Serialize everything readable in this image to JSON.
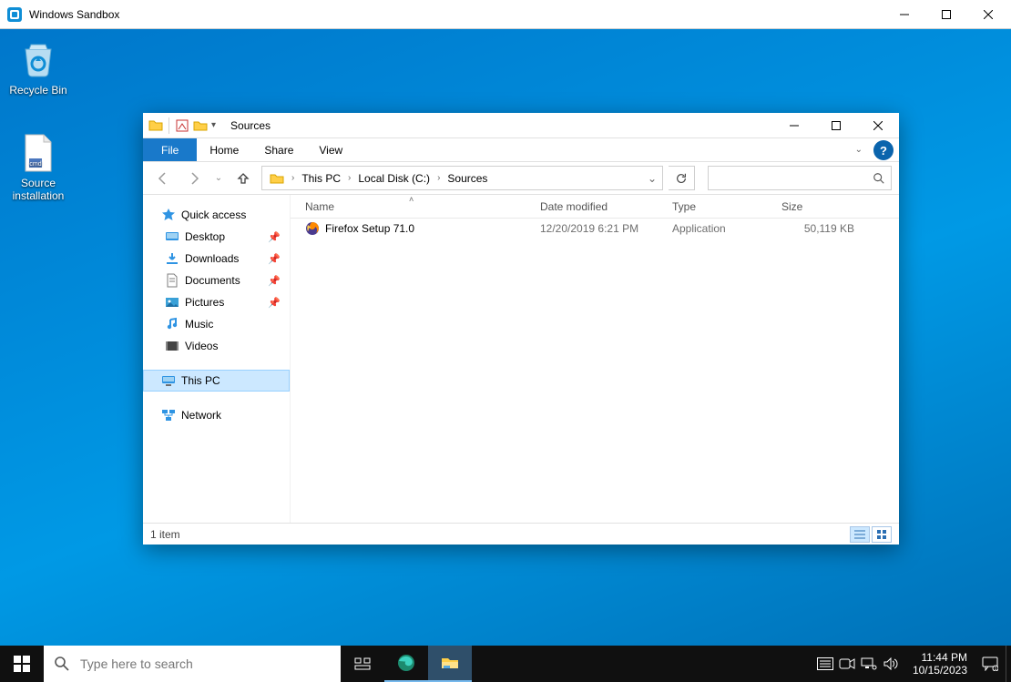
{
  "sandbox": {
    "title": "Windows Sandbox"
  },
  "desktop": {
    "recycle_bin": "Recycle Bin",
    "source_installation": "Source installation"
  },
  "explorer": {
    "title": "Sources",
    "menu": {
      "file": "File",
      "home": "Home",
      "share": "Share",
      "view": "View"
    },
    "breadcrumbs": {
      "pc": "This PC",
      "disk": "Local Disk (C:)",
      "sources": "Sources"
    },
    "columns": {
      "name": "Name",
      "modified": "Date modified",
      "type": "Type",
      "size": "Size"
    },
    "navpane": {
      "quick_access": "Quick access",
      "desktop": "Desktop",
      "downloads": "Downloads",
      "documents": "Documents",
      "pictures": "Pictures",
      "music": "Music",
      "videos": "Videos",
      "this_pc": "This PC",
      "network": "Network"
    },
    "files": [
      {
        "name": "Firefox Setup 71.0",
        "modified": "12/20/2019 6:21 PM",
        "type": "Application",
        "size": "50,119 KB"
      }
    ],
    "status": "1 item"
  },
  "taskbar": {
    "search_placeholder": "Type here to search"
  },
  "clock": {
    "time": "11:44 PM",
    "date": "10/15/2023"
  }
}
